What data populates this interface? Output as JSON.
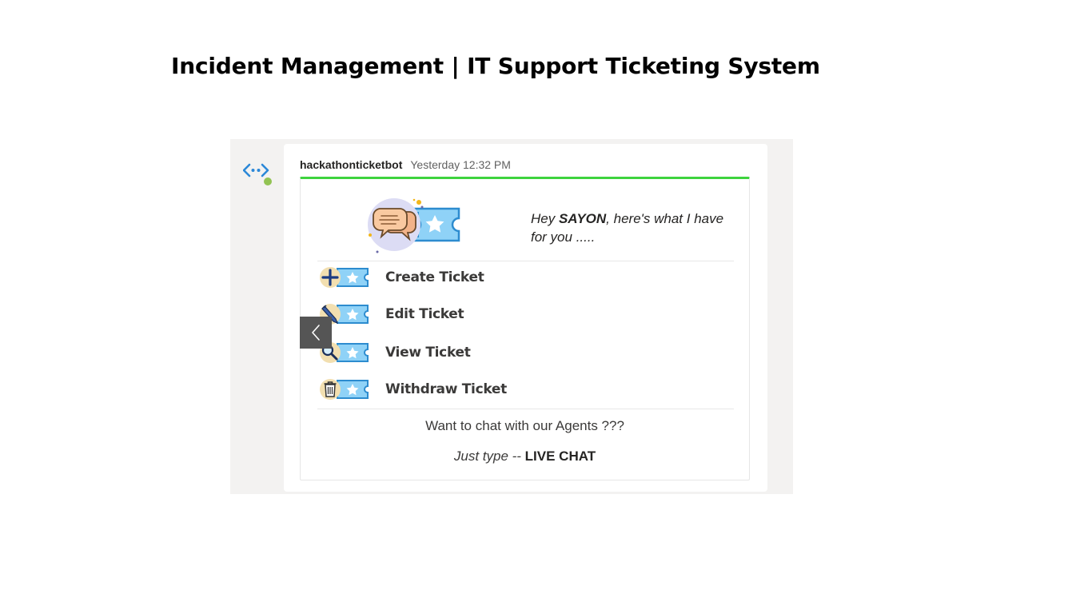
{
  "page": {
    "title": "Incident Management | IT Support Ticketing System"
  },
  "message": {
    "sender": "hackathonticketbot",
    "timestamp": "Yesterday 12:32 PM",
    "status": "available",
    "colors": {
      "accent_bar": "#3ed33e",
      "bot_icon": "#2b88d8",
      "status_dot": "#92c353"
    }
  },
  "card": {
    "greeting": {
      "prefix": "Hey ",
      "name": "SAYON",
      "suffix": ", here's what I have for you ....."
    },
    "actions": [
      {
        "label": "Create Ticket",
        "icon": "plus-ticket-icon"
      },
      {
        "label": "Edit Ticket",
        "icon": "pencil-ticket-icon"
      },
      {
        "label": "View Ticket",
        "icon": "magnifier-ticket-icon"
      },
      {
        "label": "Withdraw Ticket",
        "icon": "trash-ticket-icon"
      }
    ],
    "chat_prompt": "Want to chat with our Agents ???",
    "chat_hint": {
      "prefix": "Just type -- ",
      "command": "LIVE CHAT"
    }
  },
  "carousel": {
    "prev_icon": "chevron-left-icon"
  }
}
